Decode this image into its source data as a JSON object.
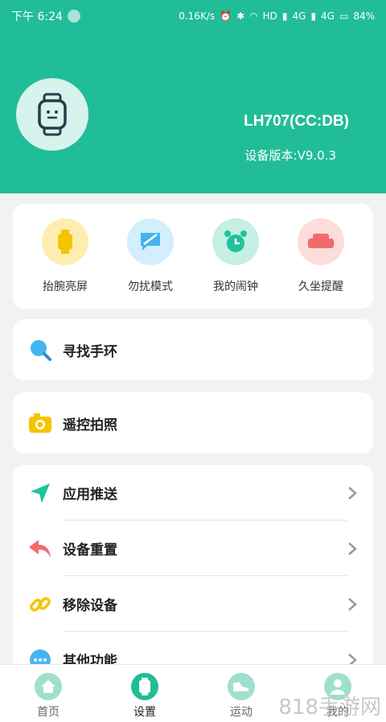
{
  "status": {
    "time": "下午 6:24",
    "speed": "0.16K/s",
    "net1": "HD",
    "net2": "4G",
    "net3": "4G",
    "battery": "84%"
  },
  "device": {
    "name": "LH707(CC:DB)",
    "version": "设备版本:V9.0.3"
  },
  "quick": [
    {
      "label": "抬腕亮屏",
      "icon": "watch-icon",
      "color": "#fdeeb0"
    },
    {
      "label": "勿扰模式",
      "icon": "message-off-icon",
      "color": "#d3eefc"
    },
    {
      "label": "我的闹钟",
      "icon": "alarm-clock-icon",
      "color": "#c5efe3"
    },
    {
      "label": "久坐提醒",
      "icon": "sofa-icon",
      "color": "#fddcdc"
    }
  ],
  "find_band": "寻找手环",
  "remote_photo": "遥控拍照",
  "list": [
    "应用推送",
    "设备重置",
    "移除设备",
    "其他功能"
  ],
  "tabs": [
    "首页",
    "设置",
    "运动",
    "我的"
  ],
  "watermark": "818手游网",
  "colors": {
    "accent": "#21bd98"
  }
}
